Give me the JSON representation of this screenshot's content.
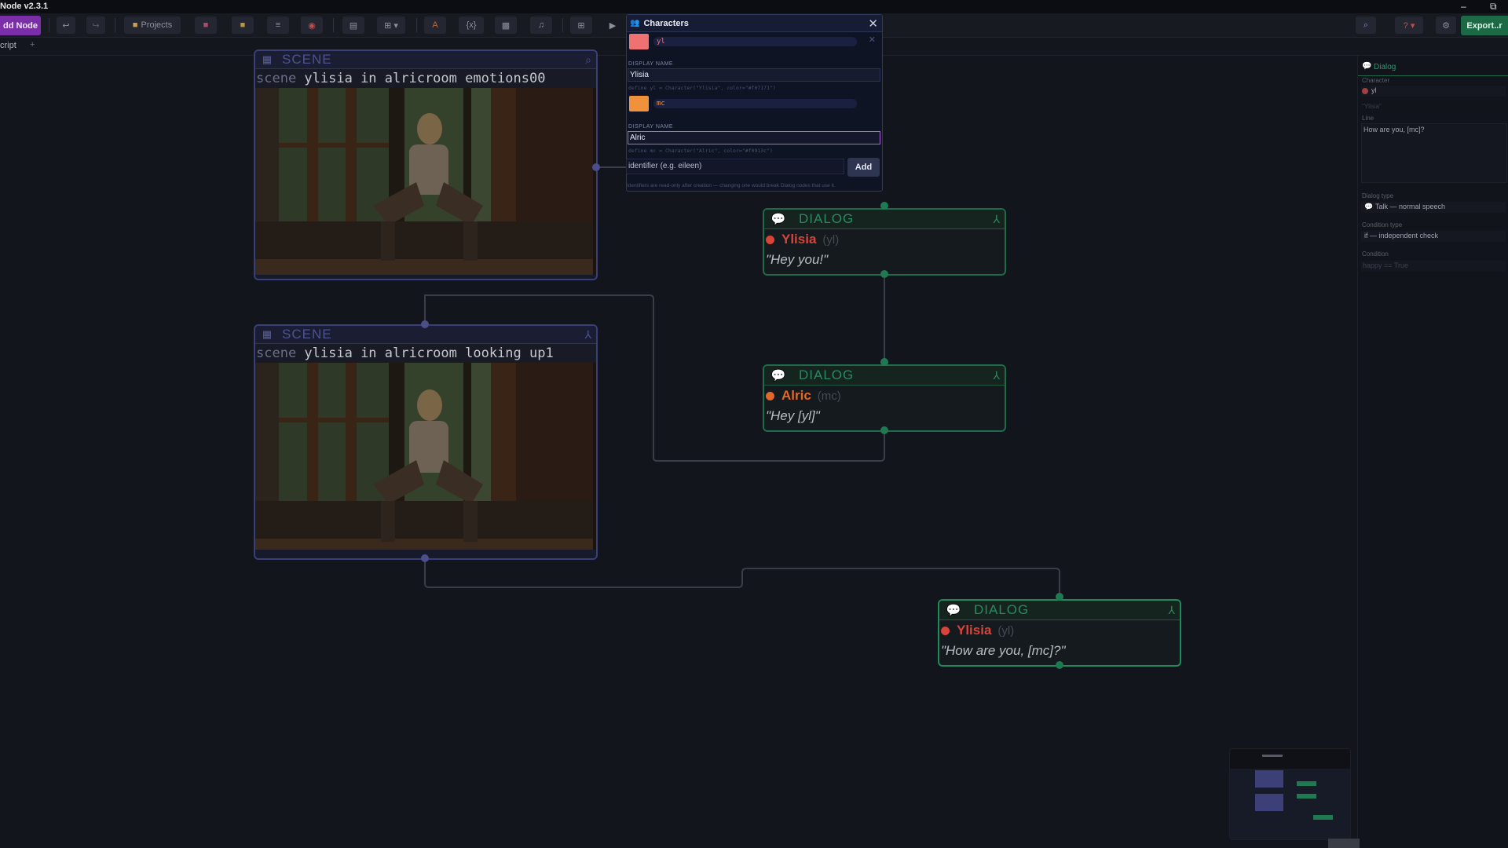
{
  "app": {
    "title": "Node v2.3.1"
  },
  "window_controls": {
    "minimize": "–",
    "maximize": "⧉"
  },
  "toolbar": {
    "add_node": "dd Node",
    "projects": "Projects",
    "export": "Export..r",
    "undo": "↩",
    "redo": "↪",
    "var": "{x}"
  },
  "tabs": [
    {
      "label": "cript"
    }
  ],
  "tab_plus": "+",
  "scenes": [
    {
      "title": "SCENE",
      "keyword": "scene",
      "statement": " ylisia in alricroom emotions00"
    },
    {
      "title": "SCENE",
      "keyword": "scene",
      "statement": " ylisia in alricroom looking up1"
    }
  ],
  "dialogs": [
    {
      "title": "DIALOG",
      "character": "Ylisia",
      "id": "(yl)",
      "line": "\"Hey you!\"",
      "color": "#d9443a"
    },
    {
      "title": "DIALOG",
      "character": "Alric",
      "id": "(mc)",
      "line": "\"Hey [yl]\"",
      "color": "#e2682a"
    },
    {
      "title": "DIALOG",
      "character": "Ylisia",
      "id": "(yl)",
      "line": "\"How are you, [mc]?\"",
      "color": "#d9443a"
    }
  ],
  "characters_panel": {
    "title": "Characters",
    "close": "✕",
    "entries": [
      {
        "id": "yl",
        "color": "#f07171",
        "display_label": "DISPLAY NAME",
        "display_name": "Ylisia",
        "define": "define yl = Character(\"Ylisia\", color=\"#f07171\")"
      },
      {
        "id": "mc",
        "color": "#f0913c",
        "display_label": "DISPLAY NAME",
        "display_name": "Alric",
        "define": "define mc = Character(\"Alric\", color=\"#f0913c\")"
      }
    ],
    "new_identifier_placeholder": "identifier  (e.g. eileen)",
    "add_button": "Add",
    "note": "Identifiers are read-only after creation — changing one would break Dialog nodes that use it."
  },
  "inspector": {
    "section": "Dialog",
    "character_label": "Character",
    "character_value": "yl",
    "character_hint": "\"Ylisia\"",
    "line_label": "Line",
    "line_value": "How are you, [mc]?",
    "dialog_type_label": "Dialog type",
    "dialog_type_value": "Talk — normal speech",
    "condition_type_label": "Condition type",
    "condition_type_value": "if — independent check",
    "condition_label": "Condition",
    "condition_placeholder": "happy == True"
  },
  "colors": {
    "accent_purple": "#7a2fa8",
    "export_green": "#1c6a45",
    "scene_border": "#3b3f78",
    "dialog_border": "#1f6a4a"
  }
}
